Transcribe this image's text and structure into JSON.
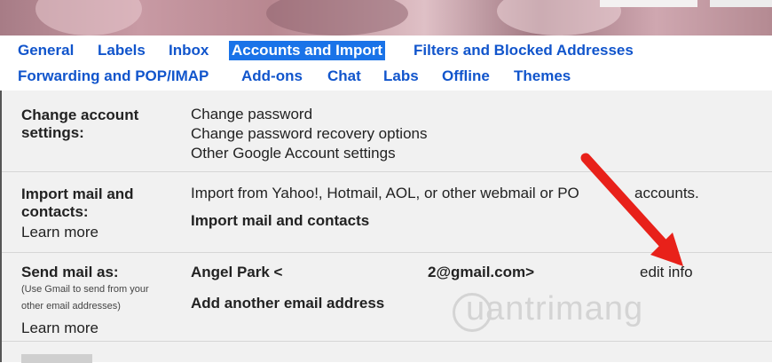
{
  "tabs": {
    "row1": [
      "General",
      "Labels",
      "Inbox",
      "Accounts and Import",
      "Filters and Blocked Addresses"
    ],
    "row2": [
      "Forwarding and POP/IMAP",
      "Add-ons",
      "Chat",
      "Labs",
      "Offline",
      "Themes"
    ],
    "active": "Accounts and Import"
  },
  "change_account": {
    "label_line1": "Change account",
    "label_line2": "settings:",
    "links": [
      "Change password",
      "Change password recovery options",
      "Other Google Account settings"
    ]
  },
  "import_mail": {
    "label_line1": "Import mail and",
    "label_line2": "contacts:",
    "learn_more": "Learn more",
    "description": "Import from Yahoo!, Hotmail, AOL, or other webmail or PO",
    "description_tail": "accounts.",
    "action_link": "Import mail and contacts"
  },
  "send_mail": {
    "label": "Send mail as:",
    "hint_line1": "(Use Gmail to send from your",
    "hint_line2": "other email addresses)",
    "learn_more": "Learn more",
    "name_part": "Angel Park <",
    "email_part": "2@gmail.com>",
    "edit_link": "edit info",
    "add_link": "Add another email address"
  },
  "watermark": "uantrimang",
  "colors": {
    "link": "#1155cc",
    "active_tab": "#1a73e8",
    "arrow": "#e8211a",
    "panel": "#f1f1f1"
  }
}
